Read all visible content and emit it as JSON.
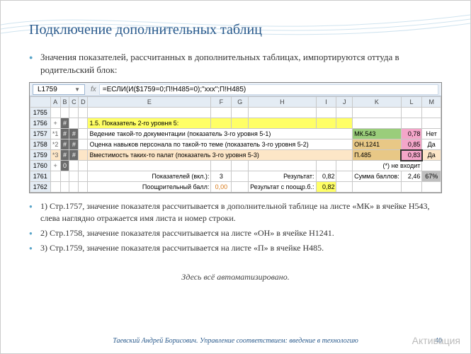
{
  "slide": {
    "title": "Подключение дополнительных таблиц",
    "intro": "Значения показателей, рассчитанных в дополнительных таблицах, импортируются оттуда в родительский блок:",
    "footnote": "Здесь всё автоматизировано.",
    "footer": "Таевский Андрей Борисович. Управление соответствием: введение в технологию",
    "page": "40",
    "watermark": "Активация"
  },
  "notes": {
    "n1": "1) Стр.1757,  значение показателя рассчитывается в дополнительной таблице на листе «МК»  в ячейке H543, слева наглядно отражается имя листа и номер строки.",
    "n2": "2) Стр.1758,  значение показателя рассчитывается на листе «ОН»  в ячейке H1241.",
    "n3": "3) Стр.1759,  значение показателя рассчитывается на листе «П»  в ячейке H485."
  },
  "sheet": {
    "active_cell": "L1759",
    "formula": "=ЕСЛИ(И($1759=0;П!H485=0);\"xxx\";П!H485)",
    "cols": [
      "A",
      "B",
      "C",
      "D",
      "E",
      "F",
      "G",
      "H",
      "I",
      "J",
      "K",
      "L",
      "M"
    ],
    "rows": [
      "1755",
      "1756",
      "1757",
      "1758",
      "1759",
      "1760",
      "1761",
      "1762"
    ],
    "r1756_B": "#",
    "r1756_E": "1.5.  Показатель 2-го уровня 5:",
    "r1757_A": "*1",
    "r1757_B": "#",
    "r1757_C": "#",
    "r1757_E": "Ведение такой-то документации (показатель 3-го уровня 5-1)",
    "r1757_K": "МК.543",
    "r1757_L": "0,78",
    "r1757_M": "Нет",
    "r1758_A": "*2",
    "r1758_B": "#",
    "r1758_C": "#",
    "r1758_E": "Оценка навыков персонала по такой-то теме (показатель 3-го уровня 5-2)",
    "r1758_K": "ОН.1241",
    "r1758_L": "0,85",
    "r1758_M": "Да",
    "r1759_A": "*3",
    "r1759_B": "#",
    "r1759_C": "#",
    "r1759_E": "Вместимость таких-то палат (показатель 3-го уровня 5-3)",
    "r1759_K": "П.485",
    "r1759_L": "0,83",
    "r1759_M": "Да",
    "r1760_B": "0",
    "r1760_K": "(*) не входит",
    "r1761_E": "Показателей (вкл.):",
    "r1761_F": "3",
    "r1761_H": "Результат:",
    "r1761_I": "0,82",
    "r1761_K": "Сумма баллов:",
    "r1761_L": "2,46",
    "r1761_M": "67%",
    "r1762_E": "Поощрительный балл:",
    "r1762_F": "0,00",
    "r1762_H": "Результат с поощр.б.:",
    "r1762_I": "0,82"
  }
}
